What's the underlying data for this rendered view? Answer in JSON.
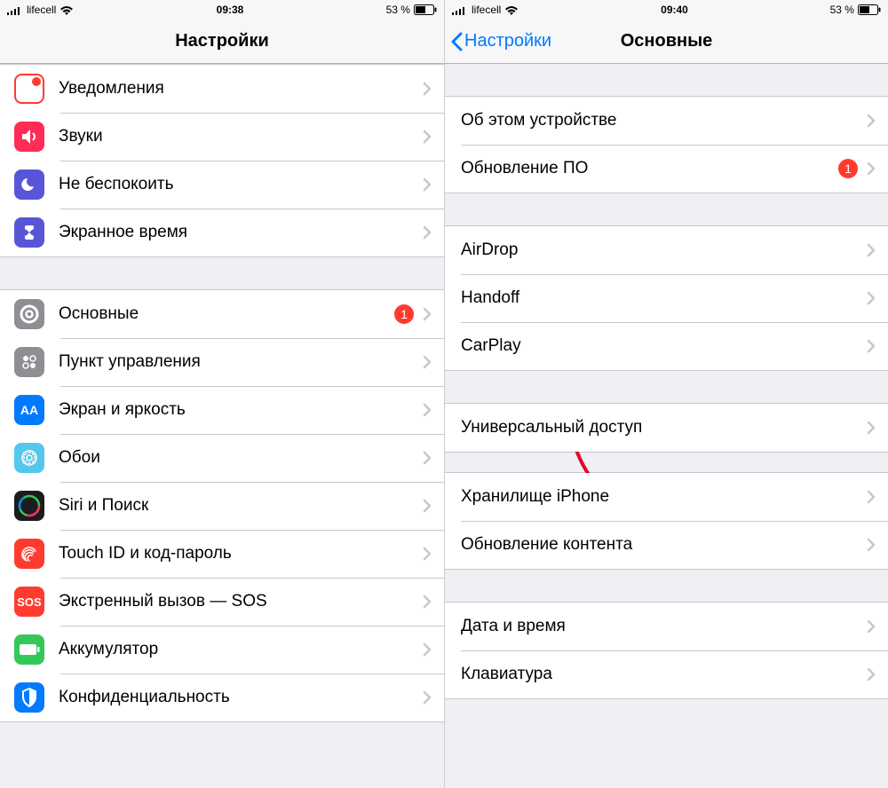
{
  "status": {
    "carrier": "lifecell",
    "battery_pct": "53 %"
  },
  "left": {
    "time": "09:38",
    "title": "Настройки",
    "group1": [
      {
        "label": "Уведомления",
        "color": "#ff3b30",
        "icon": "notify"
      },
      {
        "label": "Звуки",
        "color": "#ff2d55",
        "icon": "sound"
      },
      {
        "label": "Не беспокоить",
        "color": "#5856d6",
        "icon": "dnd"
      },
      {
        "label": "Экранное время",
        "color": "#5856d6",
        "icon": "screentime"
      }
    ],
    "group2": [
      {
        "label": "Основные",
        "color": "#8e8e93",
        "icon": "gear",
        "badge": "1"
      },
      {
        "label": "Пункт управления",
        "color": "#8e8e93",
        "icon": "control"
      },
      {
        "label": "Экран и яркость",
        "color": "#007aff",
        "icon": "display"
      },
      {
        "label": "Обои",
        "color": "#54c7ec",
        "icon": "wallpaper"
      },
      {
        "label": "Siri и Поиск",
        "color": "#1c1c1e",
        "icon": "siri"
      },
      {
        "label": "Touch ID и код-пароль",
        "color": "#ff3b30",
        "icon": "touchid"
      },
      {
        "label": "Экстренный вызов — SOS",
        "color": "#ff3b30",
        "icon": "sos"
      },
      {
        "label": "Аккумулятор",
        "color": "#34c759",
        "icon": "battery"
      },
      {
        "label": "Конфиденциальность",
        "color": "#007aff",
        "icon": "privacy"
      }
    ]
  },
  "right": {
    "time": "09:40",
    "back": "Настройки",
    "title": "Основные",
    "g1": [
      {
        "label": "Об этом устройстве"
      },
      {
        "label": "Обновление ПО",
        "badge": "1"
      }
    ],
    "g2": [
      {
        "label": "AirDrop"
      },
      {
        "label": "Handoff"
      },
      {
        "label": "CarPlay"
      }
    ],
    "g3": [
      {
        "label": "Универсальный доступ"
      }
    ],
    "g4": [
      {
        "label": "Хранилище iPhone"
      },
      {
        "label": "Обновление контента"
      }
    ],
    "g5": [
      {
        "label": "Дата и время"
      },
      {
        "label": "Клавиатура"
      }
    ]
  }
}
